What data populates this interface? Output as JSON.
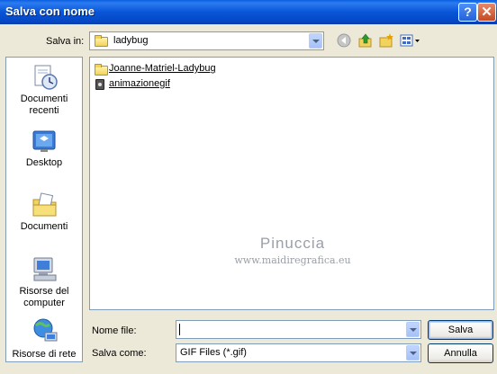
{
  "window": {
    "title": "Salva con nome"
  },
  "titlebar": {
    "help_glyph": "?",
    "close_glyph": "✕"
  },
  "save_in": {
    "label": "Salva in:",
    "value": "ladybug"
  },
  "places": [
    {
      "label": "Documenti recenti",
      "icon": "recent-documents-icon"
    },
    {
      "label": "Desktop",
      "icon": "desktop-icon"
    },
    {
      "label": "Documenti",
      "icon": "my-documents-icon"
    },
    {
      "label": "Risorse del computer",
      "icon": "my-computer-icon"
    },
    {
      "label": "Risorse di rete",
      "icon": "network-places-icon"
    }
  ],
  "files": [
    {
      "name": "Joanne-Matriel-Ladybug",
      "type": "folder"
    },
    {
      "name": "animazionegif",
      "type": "gif"
    }
  ],
  "watermark": {
    "line1": "Pinuccia",
    "line2": "www.maidiregrafica.eu"
  },
  "filename": {
    "label": "Nome file:",
    "value": ""
  },
  "savetype": {
    "label": "Salva come:",
    "value": "GIF Files (*.gif)"
  },
  "buttons": {
    "save": "Salva",
    "cancel": "Annulla"
  },
  "colors": {
    "titlebar": "#0a5fe0",
    "dialog_bg": "#ece9d8",
    "field_border": "#7f9db9"
  }
}
